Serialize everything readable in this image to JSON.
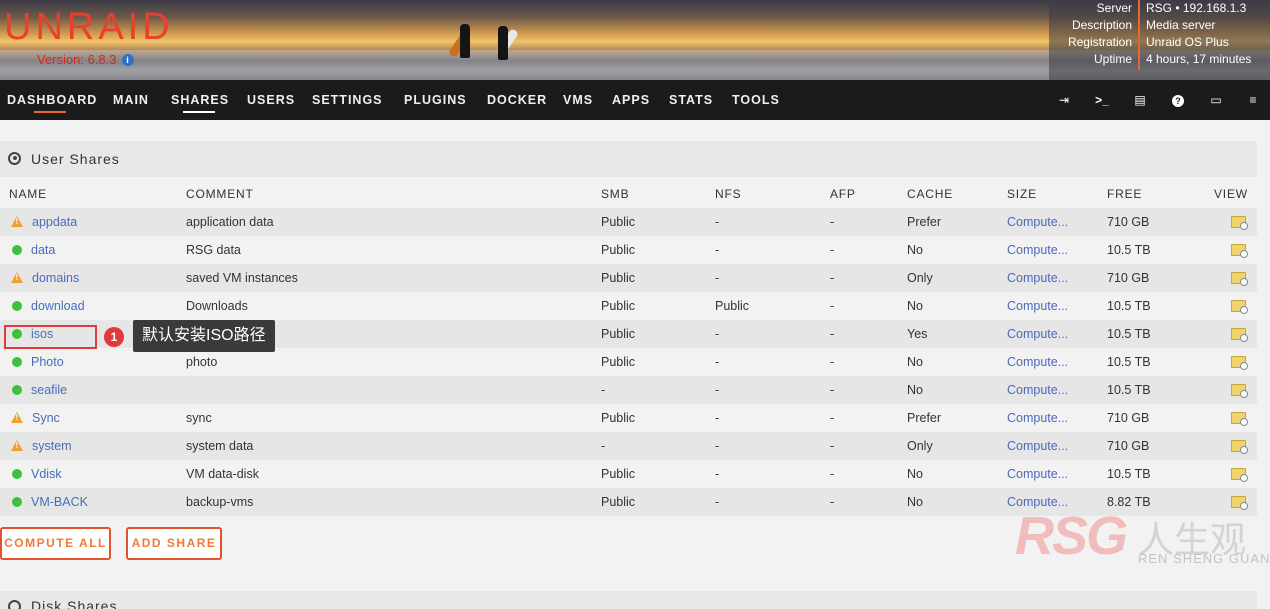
{
  "header": {
    "logo": "UNRAID",
    "version": "Version: 6.8.3",
    "server": [
      {
        "key": "Server",
        "value": "RSG • 192.168.1.3"
      },
      {
        "key": "Description",
        "value": "Media server"
      },
      {
        "key": "Registration",
        "value": "Unraid OS Plus"
      },
      {
        "key": "Uptime",
        "value": "4 hours, 17 minutes"
      }
    ]
  },
  "nav": {
    "items": [
      "DASHBOARD",
      "MAIN",
      "SHARES",
      "USERS",
      "SETTINGS",
      "PLUGINS",
      "DOCKER",
      "VMS",
      "APPS",
      "STATS",
      "TOOLS"
    ],
    "active": "SHARES",
    "icons": [
      "logout-icon",
      "terminal-icon",
      "log-icon",
      "help-icon",
      "monitor-icon",
      "menu-icon"
    ]
  },
  "user_shares": {
    "title": "User Shares",
    "columns": [
      "NAME",
      "COMMENT",
      "SMB",
      "NFS",
      "AFP",
      "CACHE",
      "SIZE",
      "FREE",
      "VIEW"
    ],
    "rows": [
      {
        "status": "warning",
        "name": "appdata",
        "comment": "application data",
        "smb": "Public",
        "nfs": "-",
        "afp": "-",
        "cache": "Prefer",
        "size": "Compute...",
        "free": "710 GB"
      },
      {
        "status": "ok",
        "name": "data",
        "comment": "RSG data",
        "smb": "Public",
        "nfs": "-",
        "afp": "-",
        "cache": "No",
        "size": "Compute...",
        "free": "10.5 TB"
      },
      {
        "status": "warning",
        "name": "domains",
        "comment": "saved VM instances",
        "smb": "Public",
        "nfs": "-",
        "afp": "-",
        "cache": "Only",
        "size": "Compute...",
        "free": "710 GB"
      },
      {
        "status": "ok",
        "name": "download",
        "comment": "Downloads",
        "smb": "Public",
        "nfs": "Public",
        "afp": "-",
        "cache": "No",
        "size": "Compute...",
        "free": "10.5 TB"
      },
      {
        "status": "ok",
        "name": "isos",
        "comment": "",
        "smb": "Public",
        "nfs": "-",
        "afp": "-",
        "cache": "Yes",
        "size": "Compute...",
        "free": "10.5 TB"
      },
      {
        "status": "ok",
        "name": "Photo",
        "comment": "photo",
        "smb": "Public",
        "nfs": "-",
        "afp": "-",
        "cache": "No",
        "size": "Compute...",
        "free": "10.5 TB"
      },
      {
        "status": "ok",
        "name": "seafile",
        "comment": "",
        "smb": "-",
        "nfs": "-",
        "afp": "-",
        "cache": "No",
        "size": "Compute...",
        "free": "10.5 TB"
      },
      {
        "status": "warning",
        "name": "Sync",
        "comment": "sync",
        "smb": "Public",
        "nfs": "-",
        "afp": "-",
        "cache": "Prefer",
        "size": "Compute...",
        "free": "710 GB"
      },
      {
        "status": "warning",
        "name": "system",
        "comment": "system data",
        "smb": "-",
        "nfs": "-",
        "afp": "-",
        "cache": "Only",
        "size": "Compute...",
        "free": "710 GB"
      },
      {
        "status": "ok",
        "name": "Vdisk",
        "comment": "VM data-disk",
        "smb": "Public",
        "nfs": "-",
        "afp": "-",
        "cache": "No",
        "size": "Compute...",
        "free": "10.5 TB"
      },
      {
        "status": "ok",
        "name": "VM-BACK",
        "comment": "backup-vms",
        "smb": "Public",
        "nfs": "-",
        "afp": "-",
        "cache": "No",
        "size": "Compute...",
        "free": "8.82 TB"
      }
    ],
    "buttons": {
      "compute_all": "COMPUTE ALL",
      "add_share": "ADD SHARE"
    }
  },
  "disk_shares": {
    "title": "Disk Shares"
  },
  "annotation": {
    "number": "1",
    "text": "默认安装ISO路径"
  },
  "watermark": {
    "brand": "RSG",
    "cn": "人生观",
    "en": "REN SHENG GUAN"
  },
  "colors": {
    "accent": "#e8672a",
    "link": "#486dba",
    "ok": "#3cc13a",
    "warning": "#f0a030",
    "annotation": "#e23a3a"
  }
}
